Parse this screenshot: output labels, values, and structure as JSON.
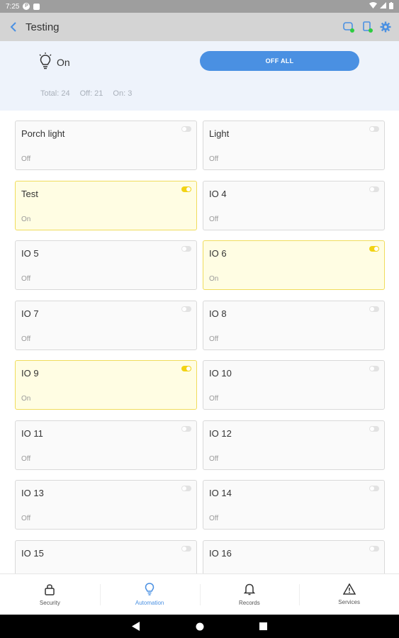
{
  "status_bar": {
    "time": "7:25"
  },
  "app_bar": {
    "title": "Testing"
  },
  "summary": {
    "state_label": "On",
    "off_all_label": "OFF ALL",
    "total": "Total: 24",
    "off": "Off: 21",
    "on": "On: 3"
  },
  "devices": [
    {
      "name": "Porch light",
      "status": "Off",
      "on": false
    },
    {
      "name": "Light",
      "status": "Off",
      "on": false
    },
    {
      "name": "Test",
      "status": "On",
      "on": true
    },
    {
      "name": "IO 4",
      "status": "Off",
      "on": false
    },
    {
      "name": "IO 5",
      "status": "Off",
      "on": false
    },
    {
      "name": "IO 6",
      "status": "On",
      "on": true
    },
    {
      "name": "IO 7",
      "status": "Off",
      "on": false
    },
    {
      "name": "IO 8",
      "status": "Off",
      "on": false
    },
    {
      "name": "IO 9",
      "status": "On",
      "on": true
    },
    {
      "name": "IO 10",
      "status": "Off",
      "on": false
    },
    {
      "name": "IO 11",
      "status": "Off",
      "on": false
    },
    {
      "name": "IO 12",
      "status": "Off",
      "on": false
    },
    {
      "name": "IO 13",
      "status": "Off",
      "on": false
    },
    {
      "name": "IO 14",
      "status": "Off",
      "on": false
    },
    {
      "name": "IO 15",
      "status": "",
      "on": false
    },
    {
      "name": "IO 16",
      "status": "",
      "on": false
    }
  ],
  "bottom_nav": [
    {
      "label": "Security",
      "icon": "lock-icon",
      "active": false
    },
    {
      "label": "Automation",
      "icon": "bulb-icon",
      "active": true
    },
    {
      "label": "Records",
      "icon": "bell-icon",
      "active": false
    },
    {
      "label": "Services",
      "icon": "warning-icon",
      "active": false
    }
  ],
  "colors": {
    "accent": "#4a90e2",
    "on_card": "#fffde3",
    "on_border": "#f0dc5c",
    "toggle_on": "#f2d315",
    "online_dot": "#2ecc40"
  }
}
